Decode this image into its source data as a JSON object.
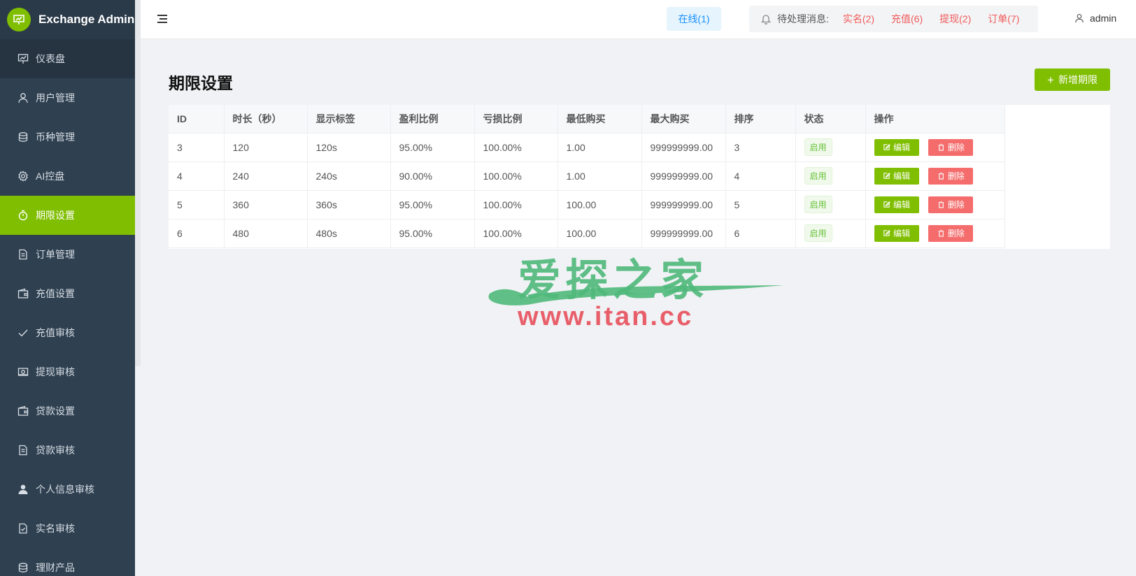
{
  "brand": {
    "title": "Exchange Admin"
  },
  "sidebar": {
    "items": [
      {
        "label": "仪表盘",
        "icon": "chart-board-icon"
      },
      {
        "label": "用户管理",
        "icon": "user-icon"
      },
      {
        "label": "币种管理",
        "icon": "database-icon"
      },
      {
        "label": "AI控盘",
        "icon": "gear-icon"
      },
      {
        "label": "期限设置",
        "icon": "stopwatch-icon"
      },
      {
        "label": "订单管理",
        "icon": "document-icon"
      },
      {
        "label": "充值设置",
        "icon": "wallet-icon"
      },
      {
        "label": "充值审核",
        "icon": "check-icon"
      },
      {
        "label": "提现审核",
        "icon": "money-icon"
      },
      {
        "label": "贷款设置",
        "icon": "wallet-icon"
      },
      {
        "label": "贷款审核",
        "icon": "document-icon"
      },
      {
        "label": "个人信息审核",
        "icon": "person-filled-icon"
      },
      {
        "label": "实名审核",
        "icon": "doc-check-icon"
      },
      {
        "label": "理财产品",
        "icon": "database-icon"
      }
    ],
    "active_index": 4
  },
  "header": {
    "online": "在线(1)",
    "pending_label": "待处理消息:",
    "pending": [
      {
        "label": "实名(2)"
      },
      {
        "label": "充值(6)"
      },
      {
        "label": "提现(2)"
      },
      {
        "label": "订单(7)"
      }
    ],
    "user": "admin"
  },
  "main": {
    "title": "期限设置",
    "add_button": "新增期限",
    "columns": [
      "ID",
      "时长（秒）",
      "显示标签",
      "盈利比例",
      "亏损比例",
      "最低购买",
      "最大购买",
      "排序",
      "状态",
      "操作"
    ],
    "rows": [
      {
        "id": "3",
        "duration": "120",
        "label": "120s",
        "profit": "95.00%",
        "loss": "100.00%",
        "min": "1.00",
        "max": "999999999.00",
        "sort": "3",
        "status": "启用"
      },
      {
        "id": "4",
        "duration": "240",
        "label": "240s",
        "profit": "90.00%",
        "loss": "100.00%",
        "min": "1.00",
        "max": "999999999.00",
        "sort": "4",
        "status": "启用"
      },
      {
        "id": "5",
        "duration": "360",
        "label": "360s",
        "profit": "95.00%",
        "loss": "100.00%",
        "min": "100.00",
        "max": "999999999.00",
        "sort": "5",
        "status": "启用"
      },
      {
        "id": "6",
        "duration": "480",
        "label": "480s",
        "profit": "95.00%",
        "loss": "100.00%",
        "min": "100.00",
        "max": "999999999.00",
        "sort": "6",
        "status": "启用"
      }
    ],
    "edit_label": "编辑",
    "delete_label": "删除"
  },
  "watermark": {
    "cn": "爱探之家",
    "url": "www.itan.cc"
  },
  "colors": {
    "accent": "#7fbe00",
    "sidebar": "#2f4050",
    "danger": "#f56c6c",
    "link_red": "#f05a5a",
    "info_blue": "#1890ff"
  }
}
